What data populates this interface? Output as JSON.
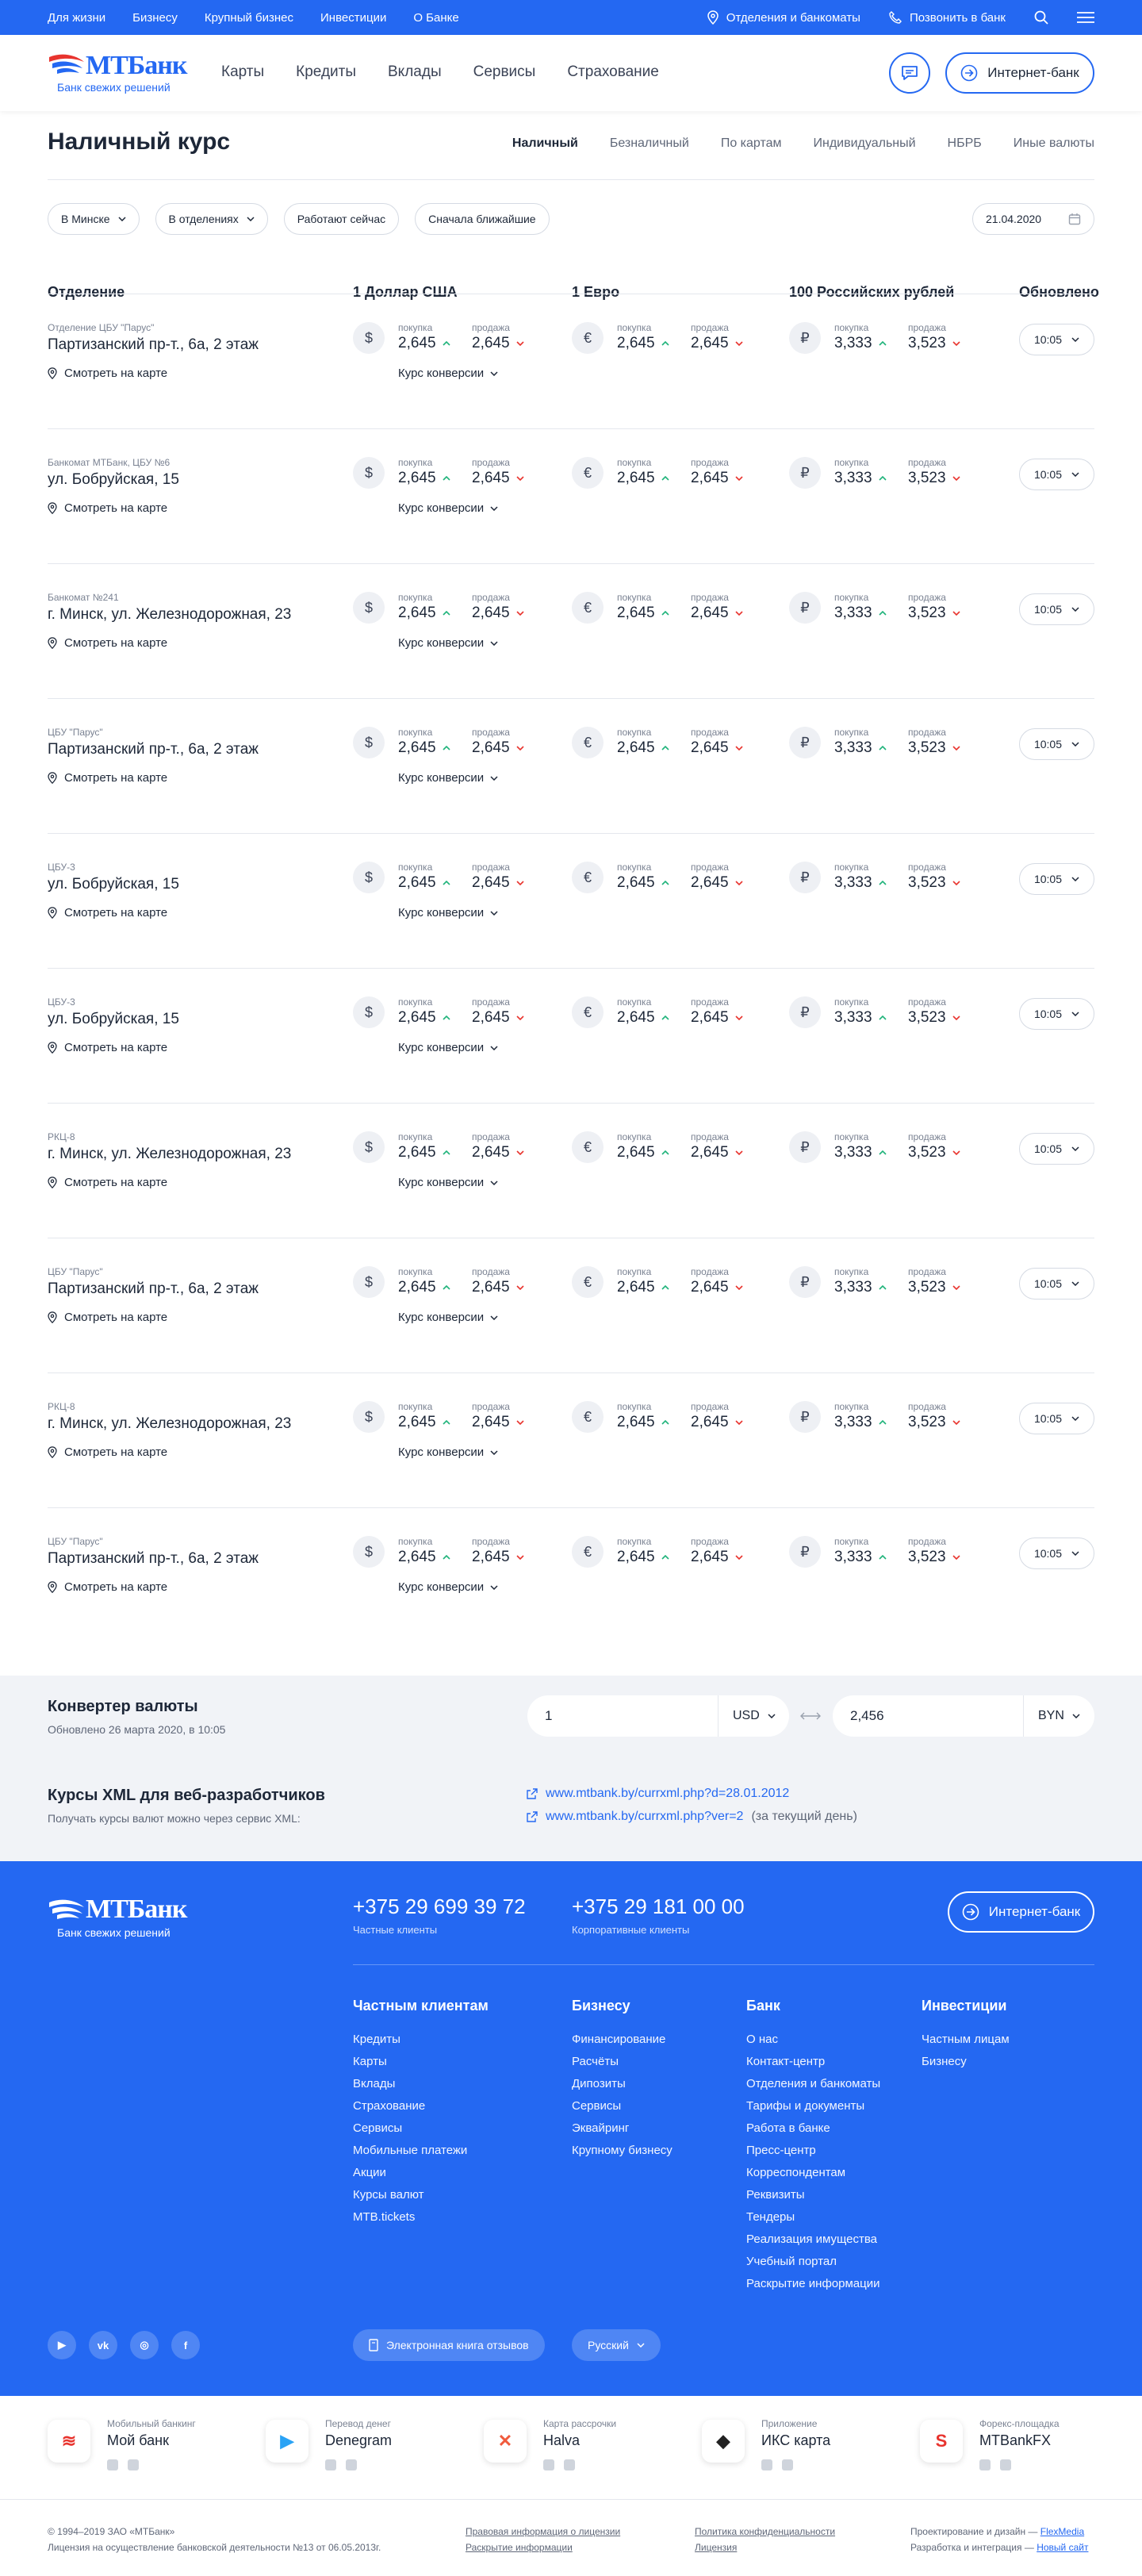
{
  "topbar": {
    "links": [
      "Для жизни",
      "Бизнесу",
      "Крупный бизнес",
      "Инвестиции",
      "О Банке"
    ],
    "branches": "Отделения и банкоматы",
    "call": "Позвонить в банк"
  },
  "header": {
    "logo_name": "МТБанк",
    "logo_sub": "Банк свежих решений",
    "nav": [
      "Карты",
      "Кредиты",
      "Вклады",
      "Сервисы",
      "Страхование"
    ],
    "internet_bank": "Интернет-банк"
  },
  "page": {
    "title": "Наличный курс",
    "tabs": [
      "Наличный",
      "Безналичный",
      "По картам",
      "Индивидуальный",
      "НБРБ",
      "Иные валюты"
    ],
    "filters": [
      "В Минске",
      "В отделениях",
      "Работают сейчас",
      "Сначала ближайшие"
    ],
    "date": "21.04.2020"
  },
  "table": {
    "headers": {
      "branch": "Отделение",
      "usd": "1 Доллар США",
      "eur": "1 Евро",
      "rub": "100 Российских рублей",
      "updated": "Обновлено"
    },
    "buy_label": "покупка",
    "sell_label": "продажа",
    "map_label": "Смотреть на карте",
    "conv_label": "Курс конверсии",
    "currency_symbols": {
      "usd": "$",
      "eur": "€",
      "rub": "₽"
    },
    "rows": [
      {
        "type": "Отделение ЦБУ \"Парус\"",
        "address": "Партизанский пр-т., 6а, 2 этаж",
        "usd_buy": "2,645",
        "usd_sell": "2,645",
        "eur_buy": "2,645",
        "eur_sell": "2,645",
        "rub_buy": "3,333",
        "rub_sell": "3,523",
        "time": "10:05"
      },
      {
        "type": "Банкомат МТБанк, ЦБУ №6",
        "address": "ул. Бобруйская, 15",
        "usd_buy": "2,645",
        "usd_sell": "2,645",
        "eur_buy": "2,645",
        "eur_sell": "2,645",
        "rub_buy": "3,333",
        "rub_sell": "3,523",
        "time": "10:05"
      },
      {
        "type": "Банкомат №241",
        "address": "г. Минск, ул. Железнодорожная, 23",
        "usd_buy": "2,645",
        "usd_sell": "2,645",
        "eur_buy": "2,645",
        "eur_sell": "2,645",
        "rub_buy": "3,333",
        "rub_sell": "3,523",
        "time": "10:05"
      },
      {
        "type": "ЦБУ \"Парус\"",
        "address": "Партизанский пр-т., 6а, 2 этаж",
        "usd_buy": "2,645",
        "usd_sell": "2,645",
        "eur_buy": "2,645",
        "eur_sell": "2,645",
        "rub_buy": "3,333",
        "rub_sell": "3,523",
        "time": "10:05"
      },
      {
        "type": "ЦБУ-3",
        "address": "ул. Бобруйская, 15",
        "usd_buy": "2,645",
        "usd_sell": "2,645",
        "eur_buy": "2,645",
        "eur_sell": "2,645",
        "rub_buy": "3,333",
        "rub_sell": "3,523",
        "time": "10:05"
      },
      {
        "type": "ЦБУ-3",
        "address": "ул. Бобруйская, 15",
        "usd_buy": "2,645",
        "usd_sell": "2,645",
        "eur_buy": "2,645",
        "eur_sell": "2,645",
        "rub_buy": "3,333",
        "rub_sell": "3,523",
        "time": "10:05"
      },
      {
        "type": "РКЦ-8",
        "address": "г. Минск, ул. Железнодорожная, 23",
        "usd_buy": "2,645",
        "usd_sell": "2,645",
        "eur_buy": "2,645",
        "eur_sell": "2,645",
        "rub_buy": "3,333",
        "rub_sell": "3,523",
        "time": "10:05"
      },
      {
        "type": "ЦБУ \"Парус\"",
        "address": "Партизанский пр-т., 6а, 2 этаж",
        "usd_buy": "2,645",
        "usd_sell": "2,645",
        "eur_buy": "2,645",
        "eur_sell": "2,645",
        "rub_buy": "3,333",
        "rub_sell": "3,523",
        "time": "10:05"
      },
      {
        "type": "РКЦ-8",
        "address": "г. Минск, ул. Железнодорожная, 23",
        "usd_buy": "2,645",
        "usd_sell": "2,645",
        "eur_buy": "2,645",
        "eur_sell": "2,645",
        "rub_buy": "3,333",
        "rub_sell": "3,523",
        "time": "10:05"
      },
      {
        "type": "ЦБУ \"Парус\"",
        "address": "Партизанский пр-т., 6а, 2 этаж",
        "usd_buy": "2,645",
        "usd_sell": "2,645",
        "eur_buy": "2,645",
        "eur_sell": "2,645",
        "rub_buy": "3,333",
        "rub_sell": "3,523",
        "time": "10:05"
      }
    ]
  },
  "converter": {
    "title": "Конвертер валюты",
    "subtitle": "Обновлено 26 марта 2020, в 10:05",
    "from_value": "1",
    "from_currency": "USD",
    "to_value": "2,456",
    "to_currency": "BYN"
  },
  "xml": {
    "title": "Курсы XML для веб-разработчиков",
    "subtitle": "Получать курсы валют можно через сервис XML:",
    "link1": "www.mtbank.by/currxml.php?d=28.01.2012",
    "link2": "www.mtbank.by/currxml.php?ver=2",
    "link2_note": "(за текущий день)"
  },
  "footer": {
    "logo_name": "МТБанк",
    "logo_sub": "Банк свежих решений",
    "phone1": "+375 29 699 39 72",
    "phone1_label": "Частные клиенты",
    "phone2": "+375 29 181 00 00",
    "phone2_label": "Корпоративные клиенты",
    "internet_bank": "Интернет-банк",
    "columns": [
      {
        "title": "Частным клиентам",
        "items": [
          "Кредиты",
          "Карты",
          "Вклады",
          "Страхование",
          "Сервисы",
          "Мобильные платежи",
          "Акции",
          "Курсы валют",
          "MTB.tickets"
        ]
      },
      {
        "title": "Бизнесу",
        "items": [
          "Финансирование",
          "Расчёты",
          "Дипозиты",
          "Сервисы",
          "Эквайринг",
          "Крупному бизнесу"
        ]
      },
      {
        "title": "Банк",
        "items": [
          "О нас",
          "Контакт-центр",
          "Отделения и банкоматы",
          "Тарифы и документы",
          "Работа в банке",
          "Пресс-центр",
          "Корреспондентам",
          "Реквизиты",
          "Тендеры",
          "Реализация имущества",
          "Учебный портал",
          "Раскрытие информации"
        ]
      },
      {
        "title": "Инвестиции",
        "items": [
          "Частным лицам",
          "Бизнесу"
        ]
      }
    ],
    "feedback": "Электронная книга отзывов",
    "language": "Русский"
  },
  "apps": [
    {
      "label": "Мобильный банкинг",
      "name": "Мой банк",
      "color": "#e8342e"
    },
    {
      "label": "Перевод денег",
      "name": "Denegram",
      "color": "#2aa3f5"
    },
    {
      "label": "Карта рассрочки",
      "name": "Halva",
      "color": "#f05a3c"
    },
    {
      "label": "Приложение",
      "name": "ИКС карта",
      "color": "#222222"
    },
    {
      "label": "Форекс-площадка",
      "name": "MTBankFX",
      "color": "#e8342e"
    }
  ],
  "copyright": {
    "line1": "© 1994–2019 ЗАО «МТБанк»",
    "line2": "Лицензия на осуществление банковской деятельности №13 от 06.05.2013г.",
    "legal1": "Правовая информация о лицензии",
    "legal2": "Раскрытие информации",
    "privacy1": "Политика конфиденциальности",
    "privacy2": "Лицензия",
    "design": "Проектирование и дизайн —",
    "design_link": "FlexMedia",
    "dev": "Разработка и интеграция —",
    "dev_link": "Новый сайт"
  },
  "colors": {
    "accent": "#2468f2",
    "up": "#1fb37a",
    "down": "#e8342e"
  }
}
